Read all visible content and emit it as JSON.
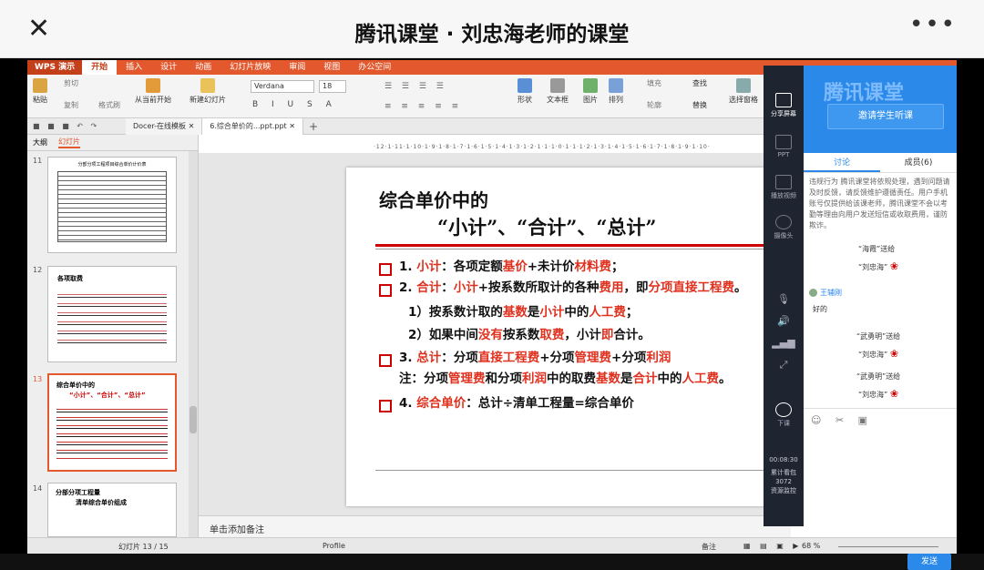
{
  "phone": {
    "title": "腾讯课堂 · 刘忠海老师的课堂",
    "close_icon": "✕",
    "more_icon": "•••"
  },
  "wps": {
    "app_button": "WPS 演示",
    "menu_tabs": [
      "开始",
      "插入",
      "设计",
      "动画",
      "幻灯片放映",
      "审阅",
      "视图",
      "办公空间"
    ],
    "ribbon": {
      "paste": "粘贴",
      "cut": "剪切",
      "copy": "复制",
      "format_brush": "格式刷",
      "from_current": "从当前开始",
      "new_slide": "新建幻灯片",
      "font": "Verdana",
      "size": "18",
      "shape": "形状",
      "textbox": "文本框",
      "picture": "图片",
      "arrange": "排列",
      "fill": "填充",
      "outline": "轮廓",
      "find": "查找",
      "replace": "替换",
      "select_pane": "选择窗格"
    },
    "doc_tabs": [
      "Docer-在线模板",
      "6.综合单价的...ppt.ppt"
    ],
    "left_tabs": [
      "大纲",
      "幻灯片"
    ],
    "thumbnails": [
      {
        "num": "11",
        "title": "分部分项工程项目综合单价计价表"
      },
      {
        "num": "12",
        "title": "各项取费"
      },
      {
        "num": "13",
        "title": "综合单价中的",
        "subtitle": "“小计”、“合计”、“总计”"
      },
      {
        "num": "14",
        "title": "分部分项工程量",
        "subtitle": "清单综合单价组成"
      }
    ],
    "ruler": "·12·1·11·1·10·1·9·1·8·1·7·1·6·1·5·1·4·1·3·1·2·1·1·1·0·1·1·1·2·1·3·1·4·1·5·1·6·1·7·1·8·1·9·1·10·",
    "slide": {
      "title_line1": "综合单价中的",
      "title_q1": "“小计”",
      "title_sep1": "、",
      "title_q2": "“合计”",
      "title_sep2": "、",
      "title_q3": "“总计”",
      "item1": {
        "num": "1. ",
        "key": "小计",
        "t1": "：各项定额",
        "r1": "基价",
        "t2": "+未计价",
        "r2": "材料费",
        "t3": "；"
      },
      "item2": {
        "num": "2. ",
        "key": "合计",
        "t1": "：",
        "r1": "小计",
        "t2": "+按系数所取计的各种",
        "r2": "费用",
        "t3": "，即",
        "r3": "分项直接工程费",
        "t4": "。"
      },
      "sub1": {
        "t0": "1）按系数计取的",
        "r1": "基数",
        "t1": "是",
        "r2": "小计",
        "t2": "中的",
        "r3": "人工费",
        "t3": "；"
      },
      "sub2": {
        "t0": "2）如果中间",
        "r1": "没有",
        "t1": "按系数",
        "r2": "取费",
        "t2": "，小计",
        "r3": "即",
        "t3": "合计。"
      },
      "item3": {
        "num": "3. ",
        "key": "总计",
        "t1": "：分项",
        "r1": "直接工程费",
        "t2": "+分项",
        "r2": "管理费",
        "t3": "+分项",
        "r3": "利润"
      },
      "note": {
        "t0": "注：分项",
        "r1": "管理费",
        "t1": "和分项",
        "r2": "利润",
        "t2": "中的取费",
        "r3": "基数",
        "t3": "是",
        "r4": "合计",
        "t4": "中的",
        "r5": "人工费",
        "t5": "。"
      },
      "item4": {
        "num": "4. ",
        "key": "综合单价",
        "t1": "：总计÷清单工程量=综合单价"
      }
    },
    "notes_placeholder": "单击添加备注",
    "status": {
      "slide": "幻灯片 13 / 15",
      "theme": "Profile",
      "notes": "备注",
      "zoom": "68 %"
    }
  },
  "overlay": {
    "brand": "腾讯课堂",
    "invite": "邀请学生听课",
    "tabs": [
      "讨论",
      "成员(6)"
    ],
    "side": [
      "分享屏幕",
      "PPT",
      "播放视频",
      "摄像头",
      "下课"
    ],
    "notice": "违规行为 腾讯课堂将依规处理，遇到问题请及时反馈，请反馈维护遵循责任。用户手机账号仅提供给该课老师，腾讯课堂不会以考勤等理由向用户发送短信或收取费用，谨防欺诈。",
    "messages": [
      {
        "from": "“海霞”送给",
        "to": "“刘忠海”"
      },
      {
        "name": "王辅刚",
        "text": "好的"
      },
      {
        "from": "“武勇明”送给",
        "to": "“刘忠海”"
      },
      {
        "from": "“武勇明”送给",
        "to": "“刘忠海”"
      }
    ],
    "time": "00:08:30",
    "stats": "累计看包",
    "stats_num": "3072",
    "stats2": "资源监控",
    "send": "发送"
  }
}
